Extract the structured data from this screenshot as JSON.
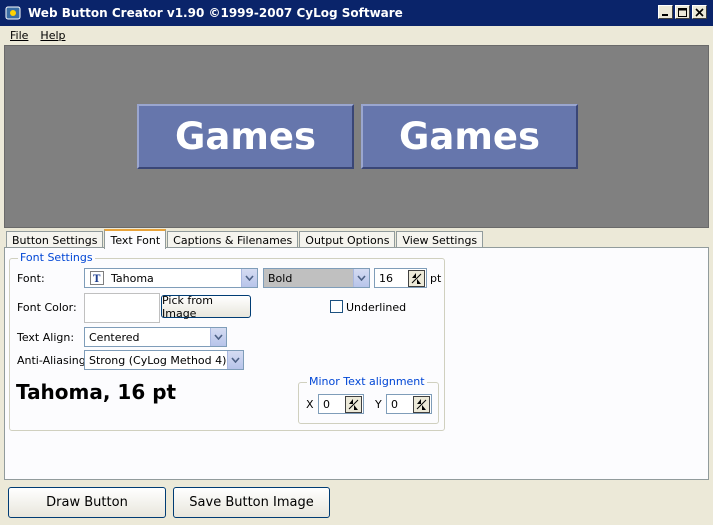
{
  "window": {
    "title": "Web Button Creator v1.90 ©1999-2007 CyLog Software"
  },
  "menu": [
    "File",
    "Help"
  ],
  "preview": {
    "buttons": [
      "Games",
      "Games"
    ],
    "button_color": "#6676ac",
    "background_color": "#808080"
  },
  "tabs": [
    "Button Settings",
    "Text Font",
    "Captions & Filenames",
    "Output Options",
    "View Settings"
  ],
  "active_tab": "Text Font",
  "font_settings": {
    "group_title": "Font Settings",
    "font_label": "Font:",
    "font_value": "Tahoma",
    "style_value": "Bold",
    "size_value": "16",
    "size_unit": "pt",
    "color_label": "Font Color:",
    "pick_button": "Pick from Image",
    "underlined_label": "Underlined",
    "underlined_checked": false,
    "align_label": "Text Align:",
    "align_value": "Centered",
    "aa_label": "Anti-Aliasing:",
    "aa_value": "Strong (CyLog Method 4)",
    "sample_text": "Tahoma, 16 pt"
  },
  "minor_alignment": {
    "title": "Minor Text alignment",
    "x_label": "X",
    "x_value": "0",
    "y_label": "Y",
    "y_value": "0"
  },
  "actions": {
    "draw": "Draw Button",
    "save": "Save Button Image"
  }
}
